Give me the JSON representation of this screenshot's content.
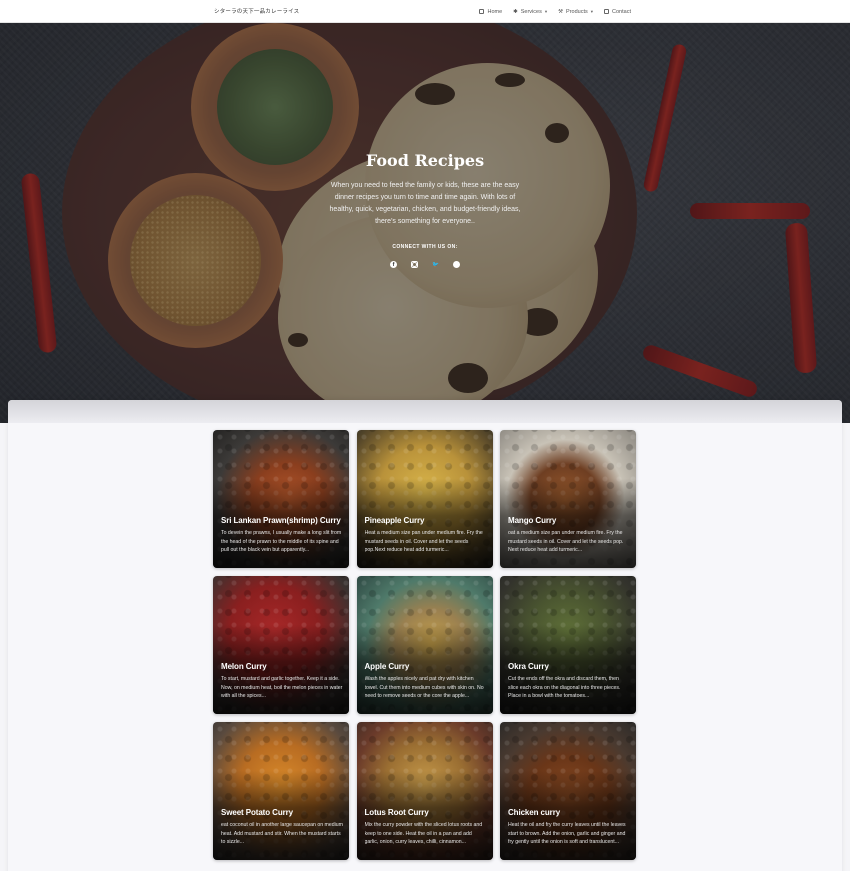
{
  "brand": "シターラの天下一品カレーライス",
  "nav": [
    {
      "label": "Home",
      "icon": "home-icon",
      "has_caret": false
    },
    {
      "label": "Services",
      "icon": "star-icon",
      "has_caret": true
    },
    {
      "label": "Products",
      "icon": "products-icon",
      "has_caret": true
    },
    {
      "label": "Contact",
      "icon": "contact-icon",
      "has_caret": false
    }
  ],
  "hero": {
    "title": "Food Recipes",
    "text": "When you need to feed the family or kids, these are the easy dinner recipes you turn to time and time again. With lots of healthy, quick, vegetarian, chicken, and budget-friendly ideas, there's something for everyone..",
    "connect": "CONNECT WITH US ON:",
    "socials": [
      "facebook-icon",
      "instagram-icon",
      "twitter-icon",
      "dribbble-icon"
    ]
  },
  "recipes": [
    {
      "title": "Sri Lankan Prawn(shrimp) Curry",
      "desc": "To devein the prawns, I usually make a long slit from the head of the prawn to the middle of its spine and pull out the black vein but apparently..."
    },
    {
      "title": "Pineapple Curry",
      "desc": "Heat a medium size pan under medium fire. Fry the mustard seeds in oil. Cover and let the seeds pop.Next reduce heat add turmeric..."
    },
    {
      "title": "Mango Curry",
      "desc": "oat a medium size pan under medium fire. Fry the mustard seeds in oil. Cover and let the seeds pop. Next reduce heat add turmeric..."
    },
    {
      "title": "Melon Curry",
      "desc": "To start, mustard and garlic together. Keep it a side. Now, on medium heat, boil the melon pieces in water with all the spices..."
    },
    {
      "title": "Apple Curry",
      "desc": "Wash the apples nicely and pat dry with kitchen towel. Cut them into medium cubes with skin on. No need to remove seeds or the core the apple..."
    },
    {
      "title": "Okra Curry",
      "desc": "Cut the ends off the okra and discard them, then slice each okra on the diagonal into three pieces. Place in a bowl with the tomatoes..."
    },
    {
      "title": "Sweet Potato Curry",
      "desc": "eat coconut oil in another large saucepan on medium heat. Add mustard and stir. When the mustard starts to sizzle..."
    },
    {
      "title": "Lotus Root Curry",
      "desc": "Mix the curry powder with the sliced lotus roots and keep to one side. Heat the oil in a pan and add garlic, onion, curry leaves, chilli, cinnamon..."
    },
    {
      "title": "Chicken curry",
      "desc": "Heat the oil and fry the curry leaves until the leaves start to brown. Add the onion, garlic and ginger and fry gently until the onion is soft and translucent..."
    }
  ]
}
